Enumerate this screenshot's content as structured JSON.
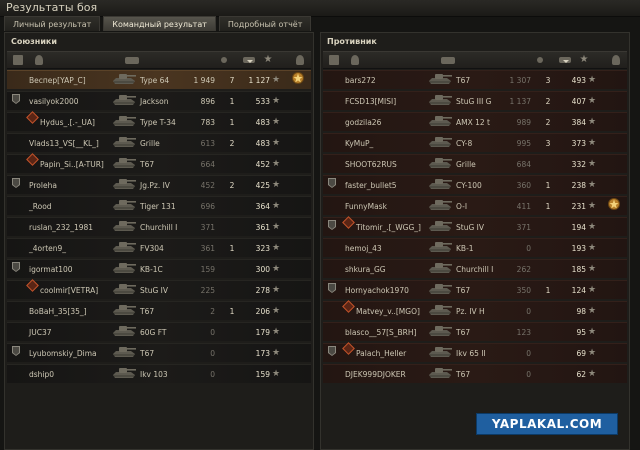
{
  "window": {
    "title": "Результаты боя"
  },
  "tabs": [
    {
      "label": "Личный результат",
      "active": false
    },
    {
      "label": "Командный результат",
      "active": true
    },
    {
      "label": "Подробный отчёт",
      "active": false
    }
  ],
  "allies": {
    "title": "Союзники",
    "players": [
      {
        "name": "Веспер[YAP_C]",
        "tank": "Type 64",
        "damage": "1 949",
        "kills": "7",
        "score": "1 127",
        "self": true,
        "medal": true,
        "badge": false,
        "platoon": false
      },
      {
        "name": "vasilyok2000",
        "tank": "Jackson",
        "damage": "896",
        "kills": "1",
        "score": "533",
        "badge": true
      },
      {
        "name": "Hydus_.[.-_UA]",
        "tank": "Type T-34",
        "damage": "783",
        "kills": "1",
        "score": "483",
        "platoon": true
      },
      {
        "name": "Vlads13_VS[__KL_]",
        "tank": "Grille",
        "damage": "613",
        "kills": "2",
        "score": "483"
      },
      {
        "name": "Papin_Si..[A-TUR]",
        "tank": "T67",
        "damage": "664",
        "kills": "",
        "score": "452",
        "platoon": true
      },
      {
        "name": "Proleha",
        "tank": "Jg.Pz. IV",
        "damage": "452",
        "kills": "2",
        "score": "425",
        "badge": true
      },
      {
        "name": "_Rood",
        "tank": "Tiger 131",
        "damage": "696",
        "kills": "",
        "score": "364"
      },
      {
        "name": "ruslan_232_1981",
        "tank": "Churchill I",
        "damage": "371",
        "kills": "",
        "score": "361"
      },
      {
        "name": "_4orten9_",
        "tank": "FV304",
        "damage": "361",
        "kills": "1",
        "score": "323"
      },
      {
        "name": "igormat100",
        "tank": "KB-1C",
        "damage": "159",
        "kills": "",
        "score": "300",
        "badge": true
      },
      {
        "name": "coolmir[VETRA]",
        "tank": "StuG IV",
        "damage": "225",
        "kills": "",
        "score": "278",
        "platoon": true
      },
      {
        "name": "BoBaH_35[35_]",
        "tank": "T67",
        "damage": "2",
        "kills": "1",
        "score": "206"
      },
      {
        "name": "JUC37",
        "tank": "60G FT",
        "damage": "0",
        "kills": "",
        "score": "179"
      },
      {
        "name": "Lyubomskiy_Dima",
        "tank": "T67",
        "damage": "0",
        "kills": "",
        "score": "173",
        "badge": true
      },
      {
        "name": "dship0",
        "tank": "Ikv 103",
        "damage": "0",
        "kills": "",
        "score": "159"
      }
    ]
  },
  "enemies": {
    "title": "Противник",
    "players": [
      {
        "name": "bars272",
        "tank": "T67",
        "damage": "1 307",
        "kills": "3",
        "score": "493"
      },
      {
        "name": "FCSD13[MISI]",
        "tank": "StuG III G",
        "damage": "1 137",
        "kills": "2",
        "score": "407"
      },
      {
        "name": "godzila26",
        "tank": "AMX 12 t",
        "damage": "989",
        "kills": "2",
        "score": "384"
      },
      {
        "name": "KyMuP_",
        "tank": "CY-8",
        "damage": "995",
        "kills": "3",
        "score": "373"
      },
      {
        "name": "SHOOT62RUS",
        "tank": "Grille",
        "damage": "684",
        "kills": "",
        "score": "332"
      },
      {
        "name": "faster_bullet5",
        "tank": "CY-100",
        "damage": "360",
        "kills": "1",
        "score": "238",
        "badge": true
      },
      {
        "name": "FunnyMask",
        "tank": "O-I",
        "damage": "411",
        "kills": "1",
        "score": "231",
        "medal": true
      },
      {
        "name": "Titomir_.[_WGG_]",
        "tank": "StuG IV",
        "damage": "371",
        "kills": "",
        "score": "194",
        "badge": true,
        "platoon": true
      },
      {
        "name": "hemoj_43",
        "tank": "KB-1",
        "damage": "0",
        "kills": "",
        "score": "193"
      },
      {
        "name": "shkura_GG",
        "tank": "Churchill I",
        "damage": "262",
        "kills": "",
        "score": "185"
      },
      {
        "name": "Hornyachok1970",
        "tank": "T67",
        "damage": "350",
        "kills": "1",
        "score": "124",
        "badge": true
      },
      {
        "name": "Matvey_v..[MGO]",
        "tank": "Pz. IV H",
        "damage": "0",
        "kills": "",
        "score": "98",
        "platoon": true
      },
      {
        "name": "blasco__57[S_BRH]",
        "tank": "T67",
        "damage": "123",
        "kills": "",
        "score": "95"
      },
      {
        "name": "Palach_Heller",
        "tank": "Ikv 65 II",
        "damage": "0",
        "kills": "",
        "score": "69",
        "badge": true,
        "platoon": true
      },
      {
        "name": "DJEK999DJOKER",
        "tank": "T67",
        "damage": "0",
        "kills": "",
        "score": "62"
      }
    ]
  },
  "watermark": "YAPLAKAL.COM",
  "colors": {
    "accent": "#c4542b",
    "self_row": "#4a3520",
    "watermark_bg": "#1f5fa0"
  },
  "icons": [
    "square-icon",
    "person-icon",
    "tank-icon",
    "star-icon",
    "dot-icon",
    "shield-badge-icon",
    "platoon-diamond-icon",
    "medal-icon"
  ]
}
